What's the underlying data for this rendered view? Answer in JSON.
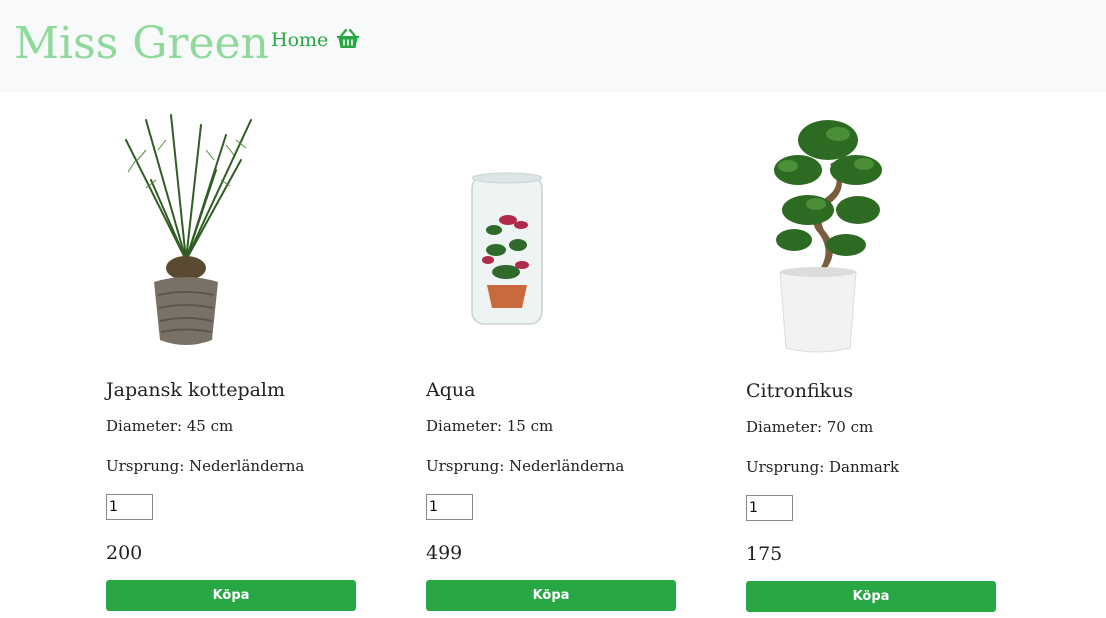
{
  "header": {
    "brand": "Miss Green",
    "home_label": "Home",
    "cart_icon": "basket-icon",
    "brand_color": "#8fd99a",
    "accent": "#28a745"
  },
  "products": [
    {
      "name": "Japansk kottepalm",
      "diameter": "Diameter: 45 cm",
      "origin": "Ursprung: Nederländerna",
      "quantity": "1",
      "price": "200",
      "buy_label": "Köpa"
    },
    {
      "name": "Aqua",
      "diameter": "Diameter: 15 cm",
      "origin": "Ursprung: Nederländerna",
      "quantity": "1",
      "price": "499",
      "buy_label": "Köpa"
    },
    {
      "name": "Citronfikus",
      "diameter": "Diameter: 70 cm",
      "origin": "Ursprung: Danmark",
      "quantity": "1",
      "price": "175",
      "buy_label": "Köpa"
    }
  ]
}
